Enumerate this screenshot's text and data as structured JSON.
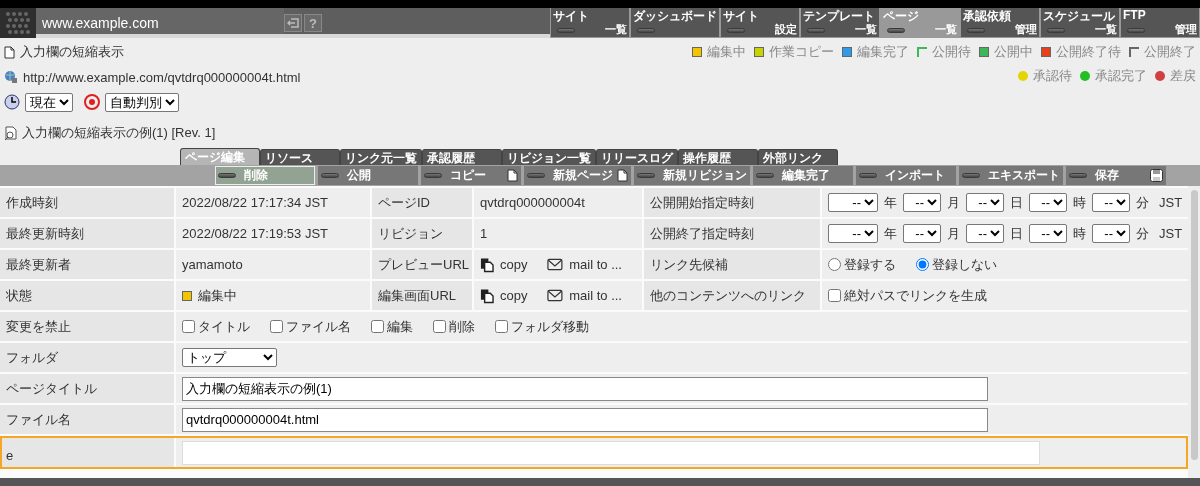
{
  "header": {
    "domain": "www.example.com",
    "help": "?"
  },
  "nav": [
    {
      "top": "サイト",
      "bottom": "一覧",
      "selected": false
    },
    {
      "top": "ダッシュボード",
      "selected": false
    },
    {
      "top": "サイト",
      "bottom": "設定",
      "selected": false
    },
    {
      "top": "テンプレート",
      "bottom": "一覧",
      "selected": false
    },
    {
      "top": "ページ",
      "bottom": "一覧",
      "selected": true
    },
    {
      "top": "承認依頼",
      "bottom": "管理",
      "selected": false
    },
    {
      "top": "スケジュール",
      "bottom": "一覧",
      "selected": false
    },
    {
      "top": "FTP",
      "bottom": "管理",
      "selected": false
    }
  ],
  "page_title": "入力欄の短縮表示",
  "url": "http://www.example.com/qvtdrq000000004t.html",
  "time_select": "現在",
  "mode_select": "自動判別",
  "revision_label": "入力欄の短縮表示の例(1)  [Rev. 1]",
  "status_legend": [
    {
      "label": "編集中",
      "color": "#f2c500"
    },
    {
      "label": "作業コピー",
      "color": "#c8d400"
    },
    {
      "label": "編集完了",
      "color": "#2f9be8"
    },
    {
      "label": "公開待",
      "color": "#3cb85a",
      "kind": "corner"
    },
    {
      "label": "公開中",
      "color": "#3cb85a"
    },
    {
      "label": "公開終了待",
      "color": "#e8401c"
    },
    {
      "label": "公開終了",
      "color": "#666666",
      "kind": "corner"
    }
  ],
  "approval_legend": [
    {
      "label": "承認待",
      "color": "#e6d400"
    },
    {
      "label": "承認完了",
      "color": "#22c022"
    },
    {
      "label": "差戻",
      "color": "#d04040"
    }
  ],
  "tabs": [
    {
      "label": "ページ編集",
      "selected": true
    },
    {
      "label": "リソース",
      "selected": false
    },
    {
      "label": "リンク元一覧",
      "selected": false
    },
    {
      "label": "承認履歴",
      "selected": false
    },
    {
      "label": "リビジョン一覧",
      "selected": false
    },
    {
      "label": "リリースログ",
      "selected": false
    },
    {
      "label": "操作履歴",
      "selected": false
    },
    {
      "label": "外部リンク",
      "selected": false
    }
  ],
  "actions": [
    {
      "label": "削除",
      "selected": true
    },
    {
      "label": "公開",
      "selected": false
    },
    {
      "label": "コピー",
      "selected": false,
      "kind": "page"
    },
    {
      "label": "新規ページ",
      "selected": false,
      "kind": "page"
    },
    {
      "label": "新規リビジョン",
      "selected": false
    },
    {
      "label": "編集完了",
      "selected": false
    },
    {
      "label": "インポート",
      "selected": false
    },
    {
      "label": "エキスポート",
      "selected": false
    },
    {
      "label": "保存",
      "selected": false,
      "kind": "disk"
    }
  ],
  "details": [
    {
      "cells": [
        {
          "kind": "label",
          "text": "作成時刻"
        },
        {
          "kind": "text",
          "text": "2022/08/22 17:17:34 JST"
        },
        {
          "kind": "label",
          "text": "ページID"
        },
        {
          "kind": "text",
          "text": "qvtdrq000000004t"
        },
        {
          "kind": "label",
          "text": "公開開始指定時刻"
        },
        {
          "kind": "datetime",
          "parts": [
            {
              "value": "--",
              "unit": "年"
            },
            {
              "value": "--",
              "unit": "月"
            },
            {
              "value": "--",
              "unit": "日"
            },
            {
              "value": "--",
              "unit": "時"
            },
            {
              "value": "--",
              "unit": "分"
            }
          ],
          "zone": "JST"
        }
      ]
    },
    {
      "cells": [
        {
          "kind": "label",
          "text": "最終更新時刻"
        },
        {
          "kind": "text",
          "text": "2022/08/22 17:19:53 JST"
        },
        {
          "kind": "label",
          "text": "リビジョン"
        },
        {
          "kind": "text",
          "text": "1"
        },
        {
          "kind": "label",
          "text": "公開終了指定時刻"
        },
        {
          "kind": "datetime",
          "parts": [
            {
              "value": "--",
              "unit": "年"
            },
            {
              "value": "--",
              "unit": "月"
            },
            {
              "value": "--",
              "unit": "日"
            },
            {
              "value": "--",
              "unit": "時"
            },
            {
              "value": "--",
              "unit": "分"
            }
          ],
          "zone": "JST"
        }
      ]
    },
    {
      "cells": [
        {
          "kind": "label",
          "text": "最終更新者"
        },
        {
          "kind": "text",
          "text": "yamamoto"
        },
        {
          "kind": "label",
          "text": "プレビューURL"
        },
        {
          "kind": "links",
          "links": [
            {
              "kind": "copy",
              "text": "copy"
            },
            {
              "kind": "mail",
              "text": "mail to ..."
            }
          ]
        },
        {
          "kind": "label",
          "text": "リンク先候補"
        },
        {
          "kind": "radios",
          "options": [
            {
              "label": "登録する",
              "selected": false
            },
            {
              "label": "登録しない",
              "selected": true
            }
          ]
        }
      ]
    },
    {
      "cells": [
        {
          "kind": "label",
          "text": "状態"
        },
        {
          "kind": "status",
          "text": "編集中",
          "color": "#f2c500"
        },
        {
          "kind": "label",
          "text": "編集画面URL"
        },
        {
          "kind": "links",
          "links": [
            {
              "kind": "copy",
              "text": "copy"
            },
            {
              "kind": "mail",
              "text": "mail to ..."
            }
          ]
        },
        {
          "kind": "label",
          "text": "他のコンテンツへのリンク"
        },
        {
          "kind": "checkboxes",
          "options": [
            {
              "label": "絶対パスでリンクを生成",
              "checked": false
            }
          ]
        }
      ]
    }
  ],
  "form_rows": [
    {
      "label": "変更を禁止",
      "kind": "checkboxes",
      "options": [
        {
          "label": "タイトル",
          "checked": false
        },
        {
          "label": "ファイル名",
          "checked": false
        },
        {
          "label": "編集",
          "checked": false
        },
        {
          "label": "削除",
          "checked": false
        },
        {
          "label": "フォルダ移動",
          "checked": false
        }
      ]
    },
    {
      "label": "フォルダ",
      "kind": "select",
      "value": "トップ"
    },
    {
      "label": "ページタイトル",
      "kind": "input",
      "value": "入力欄の短縮表示の例(1)"
    },
    {
      "label": "ファイル名",
      "kind": "input",
      "value": "qvtdrq000000004t.html"
    },
    {
      "label": "e",
      "kind": "input",
      "focused": true
    }
  ]
}
